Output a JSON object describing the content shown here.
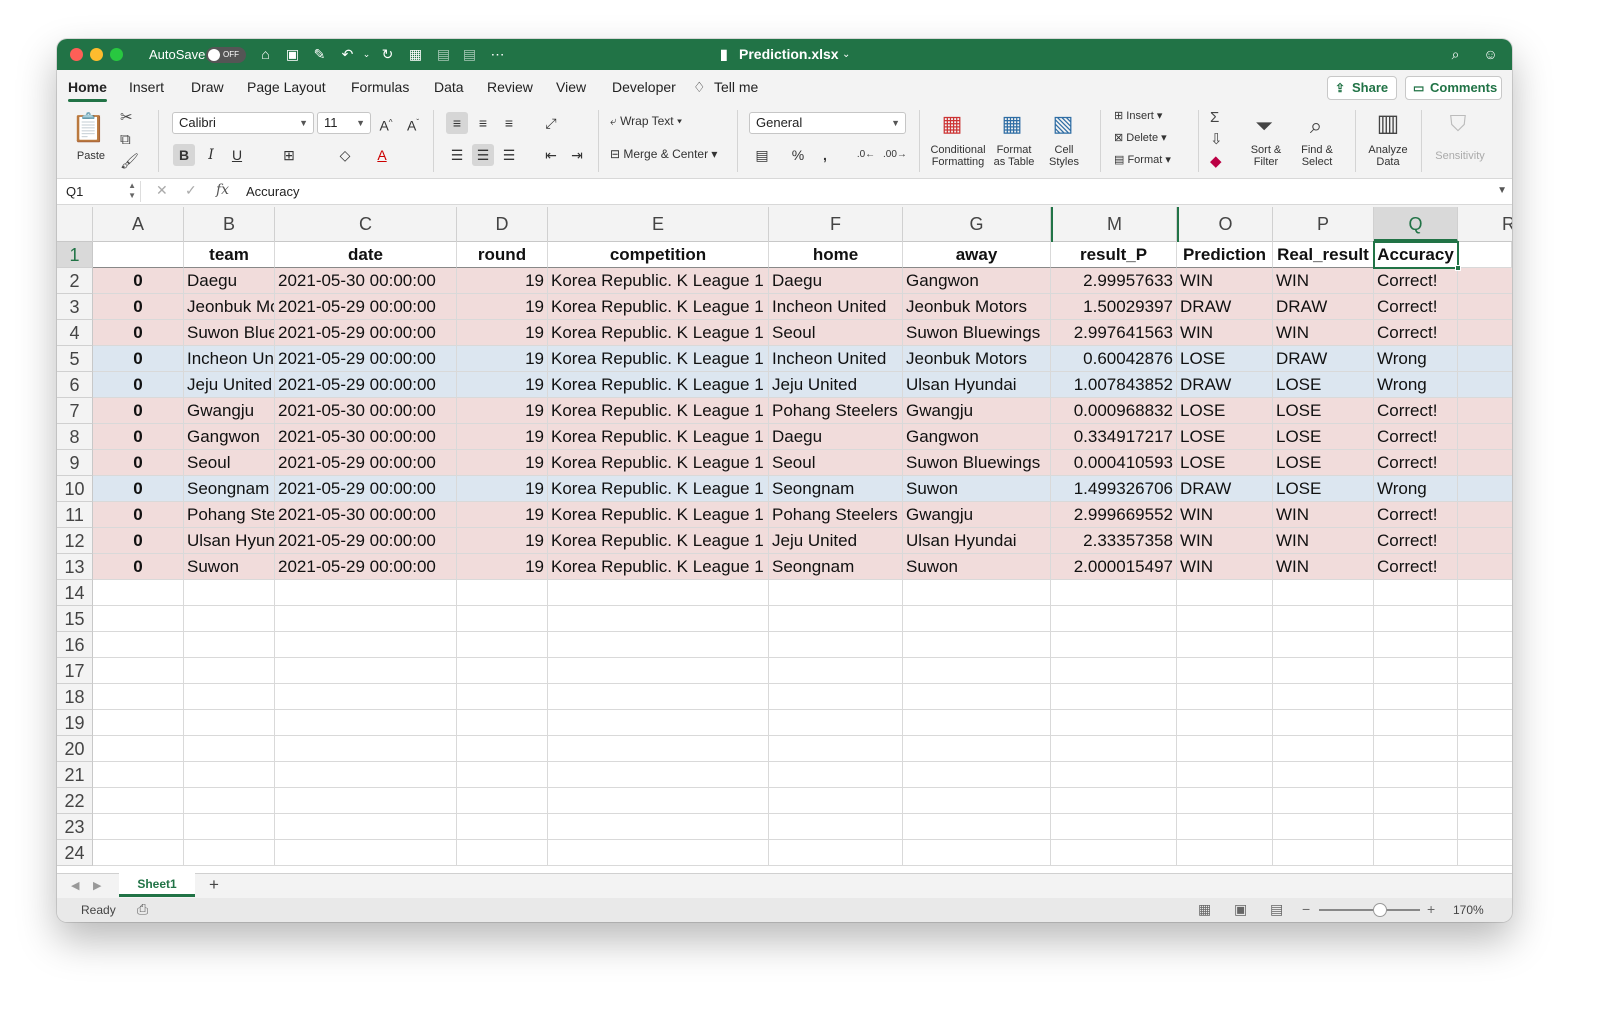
{
  "window": {
    "title": "Prediction.xlsx",
    "autosave_label": "AutoSave",
    "autosave_state": "OFF"
  },
  "ribbon_tabs": [
    "Home",
    "Insert",
    "Draw",
    "Page Layout",
    "Formulas",
    "Data",
    "Review",
    "View",
    "Developer"
  ],
  "tell_me": "Tell me",
  "share_label": "Share",
  "comments_label": "Comments",
  "ribbon": {
    "paste": "Paste",
    "font_name": "Calibri",
    "font_size": "11",
    "wrap_text": "Wrap Text",
    "merge_center": "Merge & Center",
    "number_format": "General",
    "conditional_formatting": [
      "Conditional",
      "Formatting"
    ],
    "format_as_table": [
      "Format",
      "as Table"
    ],
    "cell_styles": [
      "Cell",
      "Styles"
    ],
    "insert": "Insert",
    "delete": "Delete",
    "format": "Format",
    "sort_filter": [
      "Sort &",
      "Filter"
    ],
    "find_select": [
      "Find &",
      "Select"
    ],
    "analyze_data": [
      "Analyze",
      "Data"
    ],
    "sensitivity": "Sensitivity"
  },
  "formula_bar": {
    "name_box": "Q1",
    "fx": "fx",
    "content": "Accuracy"
  },
  "columns": [
    "A",
    "B",
    "C",
    "D",
    "E",
    "F",
    "G",
    "M",
    "O",
    "P",
    "Q",
    "R"
  ],
  "header_row": [
    "",
    "team",
    "date",
    "round",
    "competition",
    "home",
    "away",
    "result_P",
    "Prediction",
    "Real_result",
    "Accuracy"
  ],
  "rows": [
    {
      "n": "2",
      "shade": "pink",
      "cells": [
        "0",
        "Daegu",
        "2021-05-30 00:00:00",
        "19",
        "Korea Republic. K League 1",
        "Daegu",
        "Gangwon",
        "2.99957633",
        "WIN",
        "WIN",
        "Correct!"
      ]
    },
    {
      "n": "3",
      "shade": "pink",
      "cells": [
        "0",
        "Jeonbuk Mo",
        "2021-05-29 00:00:00",
        "19",
        "Korea Republic. K League 1",
        "Incheon United",
        "Jeonbuk Motors",
        "1.50029397",
        "DRAW",
        "DRAW",
        "Correct!"
      ]
    },
    {
      "n": "4",
      "shade": "pink",
      "cells": [
        "0",
        "Suwon Blue",
        "2021-05-29 00:00:00",
        "19",
        "Korea Republic. K League 1",
        "Seoul",
        "Suwon Bluewings",
        "2.997641563",
        "WIN",
        "WIN",
        "Correct!"
      ]
    },
    {
      "n": "5",
      "shade": "blue",
      "cells": [
        "0",
        "Incheon Un",
        "2021-05-29 00:00:00",
        "19",
        "Korea Republic. K League 1",
        "Incheon United",
        "Jeonbuk Motors",
        "0.60042876",
        "LOSE",
        "DRAW",
        "Wrong"
      ]
    },
    {
      "n": "6",
      "shade": "blue",
      "cells": [
        "0",
        "Jeju United",
        "2021-05-29 00:00:00",
        "19",
        "Korea Republic. K League 1",
        "Jeju United",
        "Ulsan Hyundai",
        "1.007843852",
        "DRAW",
        "LOSE",
        "Wrong"
      ]
    },
    {
      "n": "7",
      "shade": "pink",
      "cells": [
        "0",
        "Gwangju",
        "2021-05-30 00:00:00",
        "19",
        "Korea Republic. K League 1",
        "Pohang Steelers",
        "Gwangju",
        "0.000968832",
        "LOSE",
        "LOSE",
        "Correct!"
      ]
    },
    {
      "n": "8",
      "shade": "pink",
      "cells": [
        "0",
        "Gangwon",
        "2021-05-30 00:00:00",
        "19",
        "Korea Republic. K League 1",
        "Daegu",
        "Gangwon",
        "0.334917217",
        "LOSE",
        "LOSE",
        "Correct!"
      ]
    },
    {
      "n": "9",
      "shade": "pink",
      "cells": [
        "0",
        "Seoul",
        "2021-05-29 00:00:00",
        "19",
        "Korea Republic. K League 1",
        "Seoul",
        "Suwon Bluewings",
        "0.000410593",
        "LOSE",
        "LOSE",
        "Correct!"
      ]
    },
    {
      "n": "10",
      "shade": "blue",
      "cells": [
        "0",
        "Seongnam",
        "2021-05-29 00:00:00",
        "19",
        "Korea Republic. K League 1",
        "Seongnam",
        "Suwon",
        "1.499326706",
        "DRAW",
        "LOSE",
        "Wrong"
      ]
    },
    {
      "n": "11",
      "shade": "pink",
      "cells": [
        "0",
        "Pohang Ste",
        "2021-05-30 00:00:00",
        "19",
        "Korea Republic. K League 1",
        "Pohang Steelers",
        "Gwangju",
        "2.999669552",
        "WIN",
        "WIN",
        "Correct!"
      ]
    },
    {
      "n": "12",
      "shade": "pink",
      "cells": [
        "0",
        "Ulsan Hyun",
        "2021-05-29 00:00:00",
        "19",
        "Korea Republic. K League 1",
        "Jeju United",
        "Ulsan Hyundai",
        "2.33357358",
        "WIN",
        "WIN",
        "Correct!"
      ]
    },
    {
      "n": "13",
      "shade": "pink",
      "cells": [
        "0",
        "Suwon",
        "2021-05-29 00:00:00",
        "19",
        "Korea Republic. K League 1",
        "Seongnam",
        "Suwon",
        "2.000015497",
        "WIN",
        "WIN",
        "Correct!"
      ]
    }
  ],
  "empty_rows": [
    "14",
    "15",
    "16",
    "17",
    "18",
    "19",
    "20",
    "21",
    "22",
    "23",
    "24"
  ],
  "colors": {
    "accent": "#217346",
    "correct_fill": "#f1dcdb",
    "wrong_fill": "#dce6f0"
  },
  "sheet_tab": "Sheet1",
  "status": {
    "ready": "Ready",
    "zoom": "170%"
  }
}
